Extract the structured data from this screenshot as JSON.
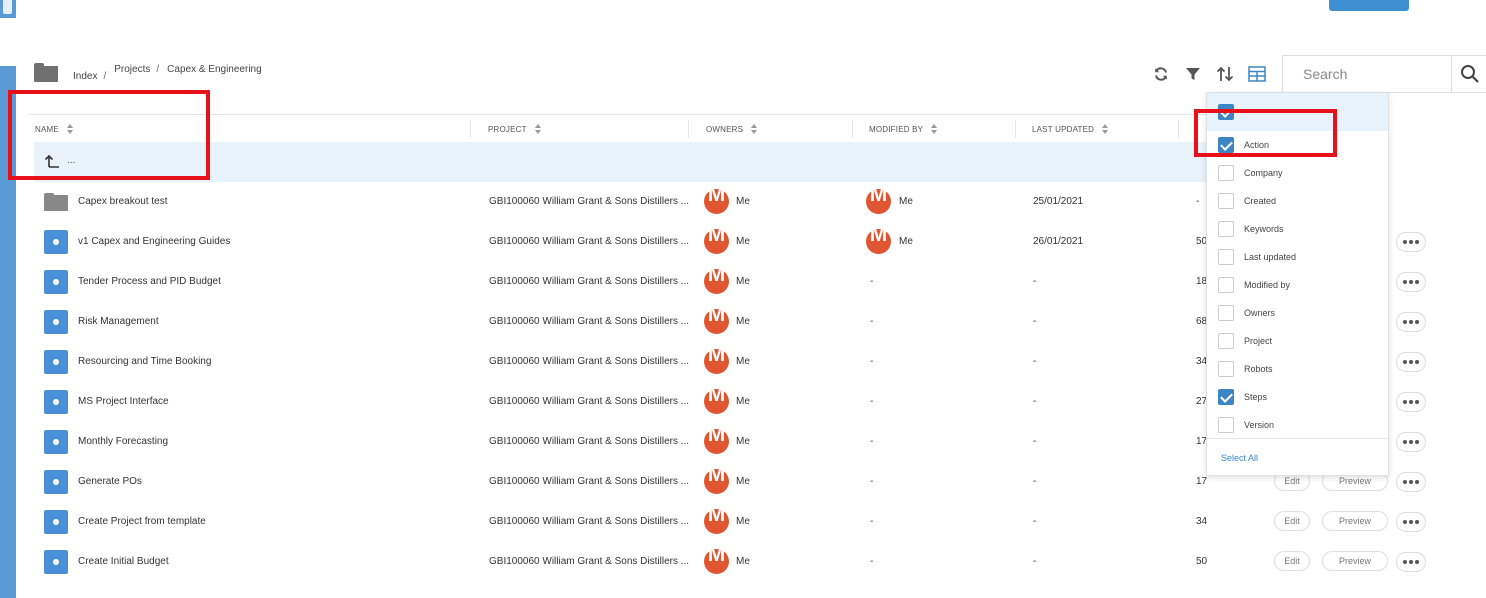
{
  "breadcrumb": {
    "items": [
      "Index",
      "Projects",
      "Capex & Engineering"
    ],
    "separator": "/"
  },
  "toolbar": {
    "icons": [
      "refresh-icon",
      "filter-icon",
      "sort-icon",
      "columns-icon"
    ],
    "accent": "#3d86c6"
  },
  "search": {
    "placeholder": "Search"
  },
  "table": {
    "columns": [
      "NAME",
      "PROJECT",
      "OWNERS",
      "MODIFIED BY",
      "LAST UPDATED"
    ],
    "up_row_label": "...",
    "rows": [
      {
        "type": "folder",
        "name": "Capex breakout test",
        "project": "GBI100060 William Grant & Sons Distillers ...",
        "owner": "Me",
        "modified_by": "Me",
        "last_updated": "25/01/2021",
        "steps": "-"
      },
      {
        "type": "process",
        "name": "v1 Capex and Engineering Guides",
        "project": "GBI100060 William Grant & Sons Distillers ...",
        "owner": "Me",
        "modified_by": "Me",
        "last_updated": "26/01/2021",
        "steps": "50"
      },
      {
        "type": "process",
        "name": "Tender Process and PID Budget",
        "project": "GBI100060 William Grant & Sons Distillers ...",
        "owner": "Me",
        "modified_by": "-",
        "last_updated": "-",
        "steps": "18"
      },
      {
        "type": "process",
        "name": "Risk Management",
        "project": "GBI100060 William Grant & Sons Distillers ...",
        "owner": "Me",
        "modified_by": "-",
        "last_updated": "-",
        "steps": "68"
      },
      {
        "type": "process",
        "name": "Resourcing and Time Booking",
        "project": "GBI100060 William Grant & Sons Distillers ...",
        "owner": "Me",
        "modified_by": "-",
        "last_updated": "-",
        "steps": "34"
      },
      {
        "type": "process",
        "name": "MS Project Interface",
        "project": "GBI100060 William Grant & Sons Distillers ...",
        "owner": "Me",
        "modified_by": "-",
        "last_updated": "-",
        "steps": "27"
      },
      {
        "type": "process",
        "name": "Monthly Forecasting",
        "project": "GBI100060 William Grant & Sons Distillers ...",
        "owner": "Me",
        "modified_by": "-",
        "last_updated": "-",
        "steps": "17"
      },
      {
        "type": "process",
        "name": "Generate POs",
        "project": "GBI100060 William Grant & Sons Distillers ...",
        "owner": "Me",
        "modified_by": "-",
        "last_updated": "-",
        "steps": "17"
      },
      {
        "type": "process",
        "name": "Create Project from template",
        "project": "GBI100060 William Grant & Sons Distillers ...",
        "owner": "Me",
        "modified_by": "-",
        "last_updated": "-",
        "steps": "34"
      },
      {
        "type": "process",
        "name": "Create Initial Budget",
        "project": "GBI100060 William Grant & Sons Distillers ...",
        "owner": "Me",
        "modified_by": "-",
        "last_updated": "-",
        "steps": "50"
      }
    ],
    "edit_label": "Edit",
    "preview_label": "Preview",
    "avatar_letter": "M",
    "avatar_color": "#e05532"
  },
  "column_menu": {
    "options": [
      {
        "label": "Action",
        "checked": true
      },
      {
        "label": "Company",
        "checked": false
      },
      {
        "label": "Created",
        "checked": false
      },
      {
        "label": "Keywords",
        "checked": false
      },
      {
        "label": "Last updated",
        "checked": false
      },
      {
        "label": "Modified by",
        "checked": false
      },
      {
        "label": "Owners",
        "checked": false
      },
      {
        "label": "Project",
        "checked": false
      },
      {
        "label": "Robots",
        "checked": false
      },
      {
        "label": "Steps",
        "checked": true
      },
      {
        "label": "Version",
        "checked": false
      }
    ],
    "select_all_label": "Select All"
  },
  "annotation_color": "#e8101a"
}
